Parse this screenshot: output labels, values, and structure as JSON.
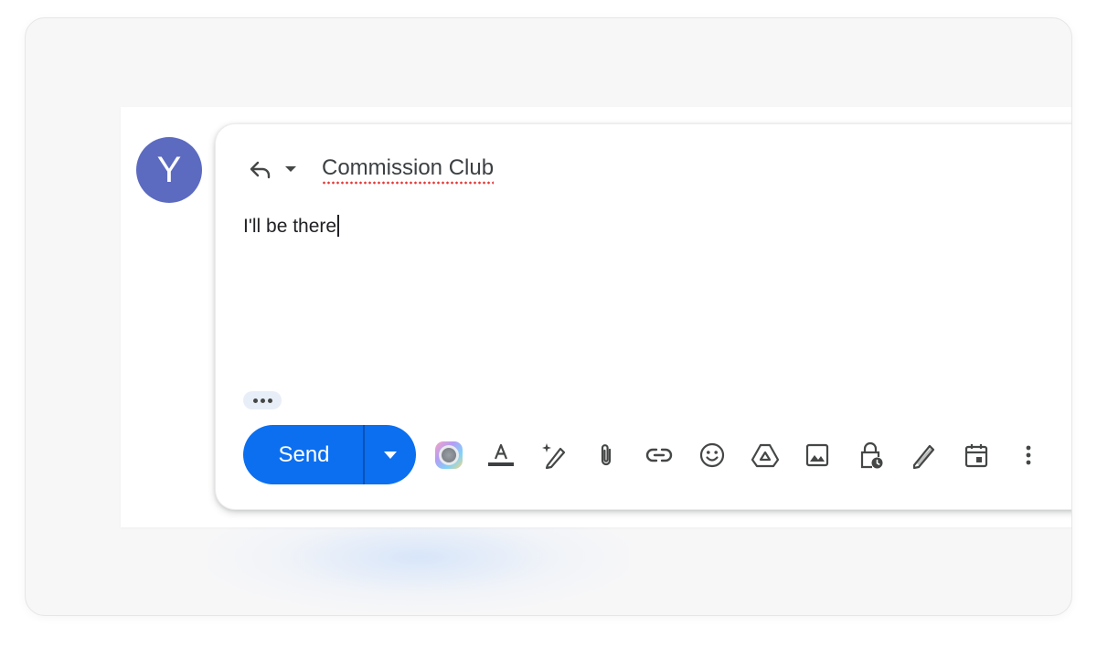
{
  "avatar": {
    "letter": "Y",
    "color": "#5c6bc0"
  },
  "compose": {
    "subject": "Commission Club",
    "body": "I'll be there",
    "send_label": "Send",
    "accent": "#0b6ff0"
  },
  "toolbar_icons": [
    "gemini-icon",
    "text-format-icon",
    "help-me-write-icon",
    "attach-icon",
    "link-icon",
    "emoji-icon",
    "drive-icon",
    "photo-icon",
    "confidential-mode-icon",
    "signature-icon",
    "schedule-event-icon",
    "more-options-icon"
  ]
}
